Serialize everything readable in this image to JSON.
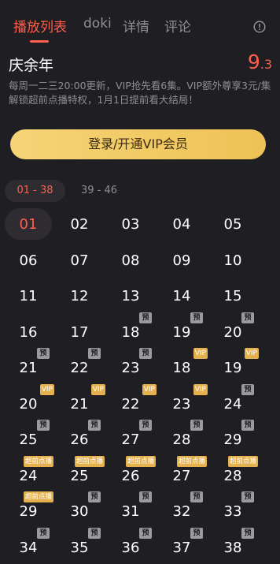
{
  "tabs": [
    "播放列表",
    "doki",
    "详情",
    "评论"
  ],
  "info_icon": "info-icon",
  "title": "庆余年",
  "score_int": "9",
  "score_dec": ".3",
  "description": "每周一二三20:00更新，VIP抢先看6集。VIP额外尊享3元/集解锁超前点播特权，1月1日提前看大结局！",
  "vip_button": "登录/开通VIP会员",
  "ranges": [
    "01 - 38",
    "39 - 46"
  ],
  "episodes": [
    {
      "num": "01",
      "badge": ""
    },
    {
      "num": "02",
      "badge": ""
    },
    {
      "num": "03",
      "badge": ""
    },
    {
      "num": "04",
      "badge": ""
    },
    {
      "num": "05",
      "badge": ""
    },
    {
      "num": "06",
      "badge": ""
    },
    {
      "num": "07",
      "badge": ""
    },
    {
      "num": "08",
      "badge": ""
    },
    {
      "num": "09",
      "badge": ""
    },
    {
      "num": "10",
      "badge": ""
    },
    {
      "num": "11",
      "badge": ""
    },
    {
      "num": "12",
      "badge": ""
    },
    {
      "num": "13",
      "badge": ""
    },
    {
      "num": "14",
      "badge": ""
    },
    {
      "num": "15",
      "badge": ""
    },
    {
      "num": "16",
      "badge": ""
    },
    {
      "num": "17",
      "badge": ""
    },
    {
      "num": "18",
      "badge": "预"
    },
    {
      "num": "19",
      "badge": "预"
    },
    {
      "num": "20",
      "badge": "预"
    },
    {
      "num": "21",
      "badge": "预"
    },
    {
      "num": "22",
      "badge": "预"
    },
    {
      "num": "23",
      "badge": "预"
    },
    {
      "num": "18",
      "badge": "VIP"
    },
    {
      "num": "19",
      "badge": "VIP"
    },
    {
      "num": "20",
      "badge": "VIP"
    },
    {
      "num": "21",
      "badge": "VIP"
    },
    {
      "num": "22",
      "badge": "VIP"
    },
    {
      "num": "23",
      "badge": "VIP"
    },
    {
      "num": "24",
      "badge": "预"
    },
    {
      "num": "25",
      "badge": "预"
    },
    {
      "num": "26",
      "badge": "预"
    },
    {
      "num": "27",
      "badge": "预"
    },
    {
      "num": "28",
      "badge": "预"
    },
    {
      "num": "29",
      "badge": "预"
    },
    {
      "num": "24",
      "badge": "超前点播"
    },
    {
      "num": "25",
      "badge": "超前点播"
    },
    {
      "num": "26",
      "badge": "超前点播"
    },
    {
      "num": "27",
      "badge": "超前点播"
    },
    {
      "num": "28",
      "badge": "超前点播"
    },
    {
      "num": "29",
      "badge": "超前点播"
    },
    {
      "num": "30",
      "badge": "预"
    },
    {
      "num": "31",
      "badge": "预"
    },
    {
      "num": "32",
      "badge": "预"
    },
    {
      "num": "33",
      "badge": "预"
    },
    {
      "num": "34",
      "badge": "预"
    },
    {
      "num": "35",
      "badge": "预"
    },
    {
      "num": "36",
      "badge": "预"
    },
    {
      "num": "37",
      "badge": "预"
    },
    {
      "num": "38",
      "badge": "预"
    }
  ],
  "selected_episode_index": 0
}
